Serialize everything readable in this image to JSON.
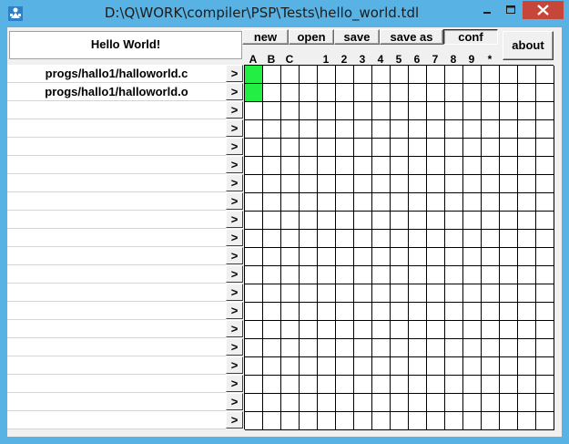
{
  "window": {
    "title": "D:\\Q\\WORK\\compiler\\PSP\\Tests\\hello_world.tdl",
    "app_icon": "app-icon",
    "colors": {
      "titlebar": "#58b3e4",
      "close_button": "#c7463a",
      "active_cell": "#22ee44"
    },
    "caption_buttons": [
      "minimize-icon",
      "maximize-icon",
      "close-icon"
    ]
  },
  "header": {
    "hello_text": "Hello World!"
  },
  "toolbar": {
    "new_label": "new",
    "open_label": "open",
    "save_label": "save",
    "save_as_label": "save as",
    "conf_label": "conf",
    "about_label": "about"
  },
  "grid": {
    "column_headers": [
      "A",
      "B",
      "C",
      "",
      "1",
      "2",
      "3",
      "4",
      "5",
      "6",
      "7",
      "8",
      "9",
      "*",
      "",
      "",
      ""
    ],
    "rows": 20,
    "columns": 17,
    "active_cells": [
      [
        0,
        0
      ],
      [
        1,
        0
      ]
    ]
  },
  "files": {
    "items": [
      "progs/hallo1/halloworld.c",
      "progs/hallo1/halloworld.o",
      "",
      "",
      "",
      "",
      "",
      "",
      "",
      "",
      "",
      "",
      "",
      "",
      "",
      "",
      "",
      "",
      "",
      ""
    ],
    "arrow_label": ">"
  }
}
